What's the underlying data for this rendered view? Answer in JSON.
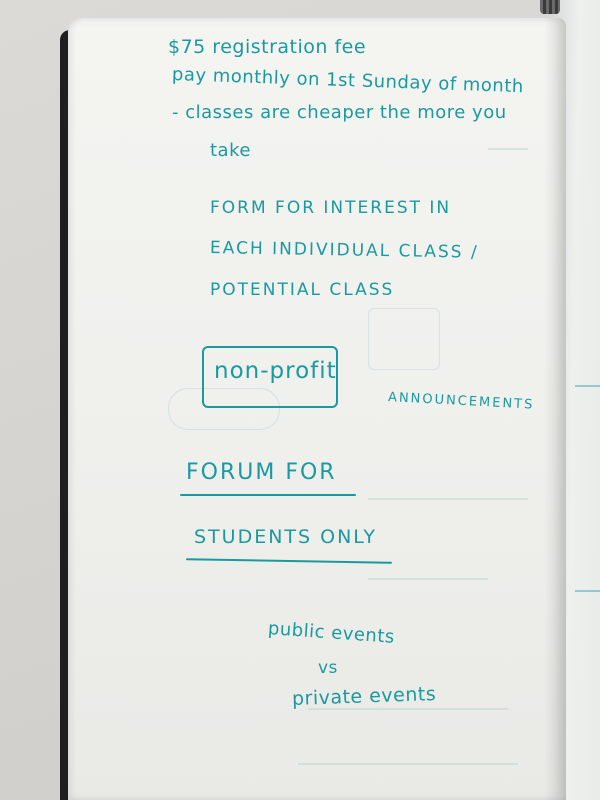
{
  "notes": {
    "line1": "$75 registration fee",
    "line2": "pay monthly on 1st Sunday of month",
    "line3": "- classes are cheaper the more you",
    "line4": "take",
    "line5": "FORM FOR INTEREST IN",
    "line6": "EACH INDIVIDUAL CLASS /",
    "line7": "POTENTIAL CLASS",
    "boxed": "non-profit",
    "announcements": "ANNOUNCEMENTS",
    "forum1": "FORUM FOR",
    "forum2": "STUDENTS ONLY",
    "events1": "public events",
    "events2": "vs",
    "events3": "private events"
  },
  "colors": {
    "ink": "#1a9aa0",
    "page": "#f2f2ef",
    "cover": "#1e1e1f"
  }
}
